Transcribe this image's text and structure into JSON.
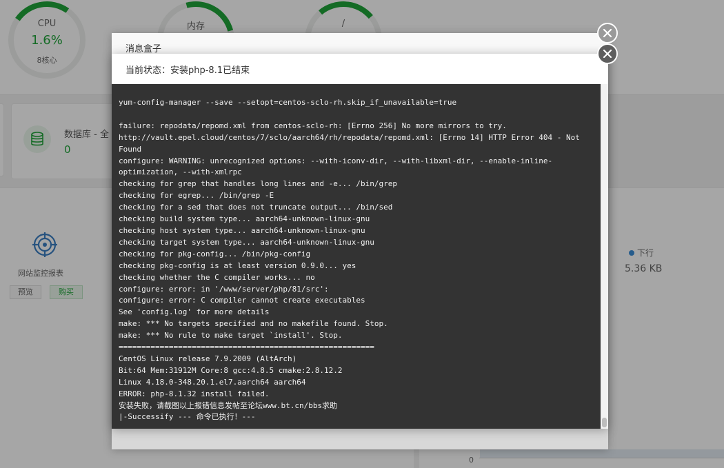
{
  "dashboard": {
    "gauges": [
      {
        "label": "CPU",
        "value": "1.6%",
        "sub": "8核心"
      },
      {
        "label": "内存",
        "value": "",
        "sub": ""
      },
      {
        "label": "/",
        "value": "",
        "sub": ""
      }
    ],
    "database": {
      "label": "数据库 - 全",
      "count": "0"
    },
    "monitor": {
      "label": "网站监控报表",
      "preview": "预览",
      "buy": "购买"
    },
    "traffic": {
      "legend": "下行",
      "value": "5.36 KB",
      "axis_zero": "0"
    }
  },
  "back_layer": {
    "title": "消息盒子"
  },
  "modal": {
    "title": "当前状态：安装php-8.1已结束",
    "console_lines": [
      "yum-config-manager --save --setopt=centos-sclo-rh.skip_if_unavailable=true",
      "",
      "failure: repodata/repomd.xml from centos-sclo-rh: [Errno 256] No more mirrors to try.",
      "http://vault.epel.cloud/centos/7/sclo/aarch64/rh/repodata/repomd.xml: [Errno 14] HTTP Error 404 - Not Found",
      "configure: WARNING: unrecognized options: --with-iconv-dir, --with-libxml-dir, --enable-inline-optimization, --with-xmlrpc",
      "checking for grep that handles long lines and -e... /bin/grep",
      "checking for egrep... /bin/grep -E",
      "checking for a sed that does not truncate output... /bin/sed",
      "checking build system type... aarch64-unknown-linux-gnu",
      "checking host system type... aarch64-unknown-linux-gnu",
      "checking target system type... aarch64-unknown-linux-gnu",
      "checking for pkg-config... /bin/pkg-config",
      "checking pkg-config is at least version 0.9.0... yes",
      "checking whether the C compiler works... no",
      "configure: error: in '/www/server/php/81/src':",
      "configure: error: C compiler cannot create executables",
      "See 'config.log' for more details",
      "make: *** No targets specified and no makefile found. Stop.",
      "make: *** No rule to make target `install'. Stop.",
      "========================================================",
      "CentOS Linux release 7.9.2009 (AltArch)",
      "Bit:64 Mem:31912M Core:8 gcc:4.8.5 cmake:2.8.12.2",
      "Linux 4.18.0-348.20.1.el7.aarch64 aarch64",
      "ERROR: php-8.1.32 install failed.",
      "安装失败，请截图以上报错信息发帖至论坛www.bt.cn/bbs求助",
      "|-Successify --- 命令已执行！---"
    ]
  },
  "colors": {
    "accent": "#20a53a",
    "console_bg": "#333333",
    "console_text": "#f0f0f0"
  }
}
